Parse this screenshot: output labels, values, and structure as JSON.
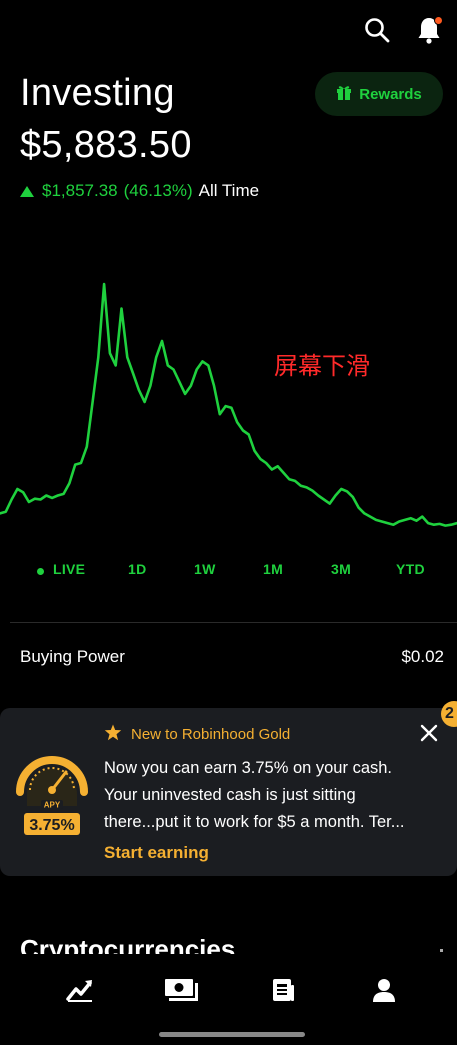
{
  "header": {
    "title": "Investing",
    "balance": "$5,883.50",
    "change_amount": "$1,857.38",
    "change_percent": "(46.13%)",
    "change_period": "All Time",
    "rewards_label": "Rewards"
  },
  "icons": {
    "search": "search-icon",
    "notifications": "bell-icon",
    "rewards": "gift-icon",
    "close": "close-icon",
    "star": "star-icon"
  },
  "annotation": "屏幕下滑",
  "chart_data": {
    "type": "line",
    "title": "",
    "xlabel": "",
    "ylabel": "",
    "color": "#1fd13e",
    "values": [
      18,
      20,
      35,
      48,
      44,
      32,
      36,
      35,
      40,
      37,
      40,
      42,
      55,
      78,
      80,
      100,
      155,
      210,
      300,
      215,
      200,
      270,
      210,
      190,
      170,
      155,
      175,
      210,
      230,
      200,
      195,
      180,
      165,
      175,
      195,
      205,
      200,
      175,
      140,
      150,
      148,
      130,
      120,
      115,
      95,
      85,
      80,
      72,
      76,
      68,
      60,
      58,
      52,
      50,
      46,
      40,
      35,
      30,
      40,
      48,
      45,
      38,
      25,
      18,
      14,
      10,
      8,
      6,
      4,
      8,
      10,
      12,
      9,
      14,
      6,
      4,
      5,
      3,
      4,
      6
    ],
    "ylim": [
      0,
      310
    ]
  },
  "ranges": [
    "LIVE",
    "1D",
    "1W",
    "1M",
    "3M",
    "YTD"
  ],
  "buying_power": {
    "label": "Buying Power",
    "value": "$0.02"
  },
  "gold_card": {
    "badge": "2",
    "title": "New to Robinhood Gold",
    "line1": "Now you can earn 3.75% on your cash.",
    "line2": "Your uninvested cash is just sitting",
    "line3": "there...put it to work for $5 a month. Ter...",
    "cta": "Start earning",
    "gauge_label": "APY",
    "gauge_rate": "3.75%"
  },
  "section_title": "Cryptocurrencies",
  "nav": [
    "chart-icon",
    "cash-icon",
    "news-icon",
    "account-icon"
  ],
  "colors": {
    "accent": "#1fd13e",
    "gold": "#f5b032",
    "background": "#000000",
    "card": "#1b1d21"
  }
}
